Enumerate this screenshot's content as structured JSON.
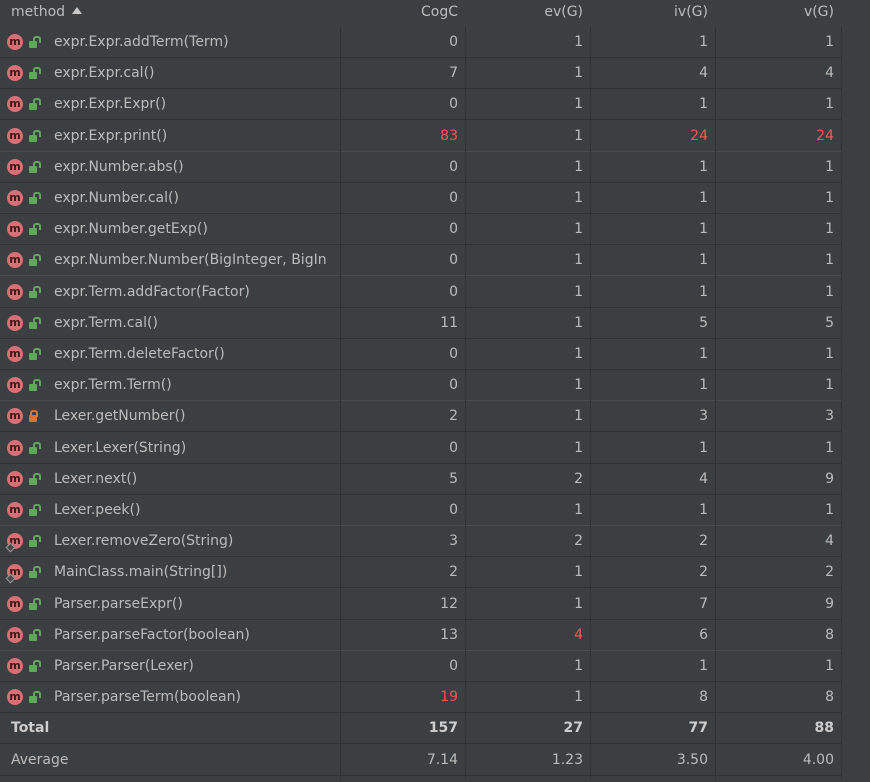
{
  "header": {
    "method": "method",
    "cogc": "CogC",
    "evg": "ev(G)",
    "ivg": "iv(G)",
    "vg": "v(G)"
  },
  "rows": [
    {
      "method": "expr.Expr.addTerm(Term)",
      "cogc": "0",
      "evg": "1",
      "ivg": "1",
      "vg": "1",
      "access": "public",
      "highlight": []
    },
    {
      "method": "expr.Expr.cal()",
      "cogc": "7",
      "evg": "1",
      "ivg": "4",
      "vg": "4",
      "access": "public",
      "highlight": []
    },
    {
      "method": "expr.Expr.Expr()",
      "cogc": "0",
      "evg": "1",
      "ivg": "1",
      "vg": "1",
      "access": "public",
      "highlight": []
    },
    {
      "method": "expr.Expr.print()",
      "cogc": "83",
      "evg": "1",
      "ivg": "24",
      "vg": "24",
      "access": "public",
      "highlight": [
        "cogc",
        "ivg",
        "vg"
      ]
    },
    {
      "method": "expr.Number.abs()",
      "cogc": "0",
      "evg": "1",
      "ivg": "1",
      "vg": "1",
      "access": "public",
      "highlight": []
    },
    {
      "method": "expr.Number.cal()",
      "cogc": "0",
      "evg": "1",
      "ivg": "1",
      "vg": "1",
      "access": "public",
      "highlight": []
    },
    {
      "method": "expr.Number.getExp()",
      "cogc": "0",
      "evg": "1",
      "ivg": "1",
      "vg": "1",
      "access": "public",
      "highlight": []
    },
    {
      "method": "expr.Number.Number(BigInteger, BigIn",
      "cogc": "0",
      "evg": "1",
      "ivg": "1",
      "vg": "1",
      "access": "public",
      "highlight": []
    },
    {
      "method": "expr.Term.addFactor(Factor)",
      "cogc": "0",
      "evg": "1",
      "ivg": "1",
      "vg": "1",
      "access": "public",
      "highlight": []
    },
    {
      "method": "expr.Term.cal()",
      "cogc": "11",
      "evg": "1",
      "ivg": "5",
      "vg": "5",
      "access": "public",
      "highlight": []
    },
    {
      "method": "expr.Term.deleteFactor()",
      "cogc": "0",
      "evg": "1",
      "ivg": "1",
      "vg": "1",
      "access": "public",
      "highlight": []
    },
    {
      "method": "expr.Term.Term()",
      "cogc": "0",
      "evg": "1",
      "ivg": "1",
      "vg": "1",
      "access": "public",
      "highlight": []
    },
    {
      "method": "Lexer.getNumber()",
      "cogc": "2",
      "evg": "1",
      "ivg": "3",
      "vg": "3",
      "access": "private",
      "highlight": []
    },
    {
      "method": "Lexer.Lexer(String)",
      "cogc": "0",
      "evg": "1",
      "ivg": "1",
      "vg": "1",
      "access": "public",
      "highlight": []
    },
    {
      "method": "Lexer.next()",
      "cogc": "5",
      "evg": "2",
      "ivg": "4",
      "vg": "9",
      "access": "public",
      "highlight": []
    },
    {
      "method": "Lexer.peek()",
      "cogc": "0",
      "evg": "1",
      "ivg": "1",
      "vg": "1",
      "access": "public",
      "highlight": []
    },
    {
      "method": "Lexer.removeZero(String)",
      "cogc": "3",
      "evg": "2",
      "ivg": "2",
      "vg": "4",
      "access": "public-static",
      "highlight": []
    },
    {
      "method": "MainClass.main(String[])",
      "cogc": "2",
      "evg": "1",
      "ivg": "2",
      "vg": "2",
      "access": "public-static",
      "highlight": []
    },
    {
      "method": "Parser.parseExpr()",
      "cogc": "12",
      "evg": "1",
      "ivg": "7",
      "vg": "9",
      "access": "public",
      "highlight": []
    },
    {
      "method": "Parser.parseFactor(boolean)",
      "cogc": "13",
      "evg": "4",
      "ivg": "6",
      "vg": "8",
      "access": "public",
      "highlight": [
        "evg"
      ]
    },
    {
      "method": "Parser.Parser(Lexer)",
      "cogc": "0",
      "evg": "1",
      "ivg": "1",
      "vg": "1",
      "access": "public",
      "highlight": []
    },
    {
      "method": "Parser.parseTerm(boolean)",
      "cogc": "19",
      "evg": "1",
      "ivg": "8",
      "vg": "8",
      "access": "public",
      "highlight": [
        "cogc"
      ]
    }
  ],
  "total": {
    "label": "Total",
    "cogc": "157",
    "evg": "27",
    "ivg": "77",
    "vg": "88"
  },
  "average": {
    "label": "Average",
    "cogc": "7.14",
    "evg": "1.23",
    "ivg": "3.50",
    "vg": "4.00"
  },
  "icons": {
    "method_badge": "m",
    "sort": "sort-ascending-icon",
    "public": "lock-open-icon",
    "private": "lock-closed-icon",
    "static": "static-diamond-icon"
  },
  "colors": {
    "background": "#3c3f41",
    "text": "#bbbbbb",
    "threshold_exceeded": "#ff5555",
    "method_badge": "#d86f77",
    "public_lock": "#5fa85a",
    "private_lock": "#d5733a"
  }
}
